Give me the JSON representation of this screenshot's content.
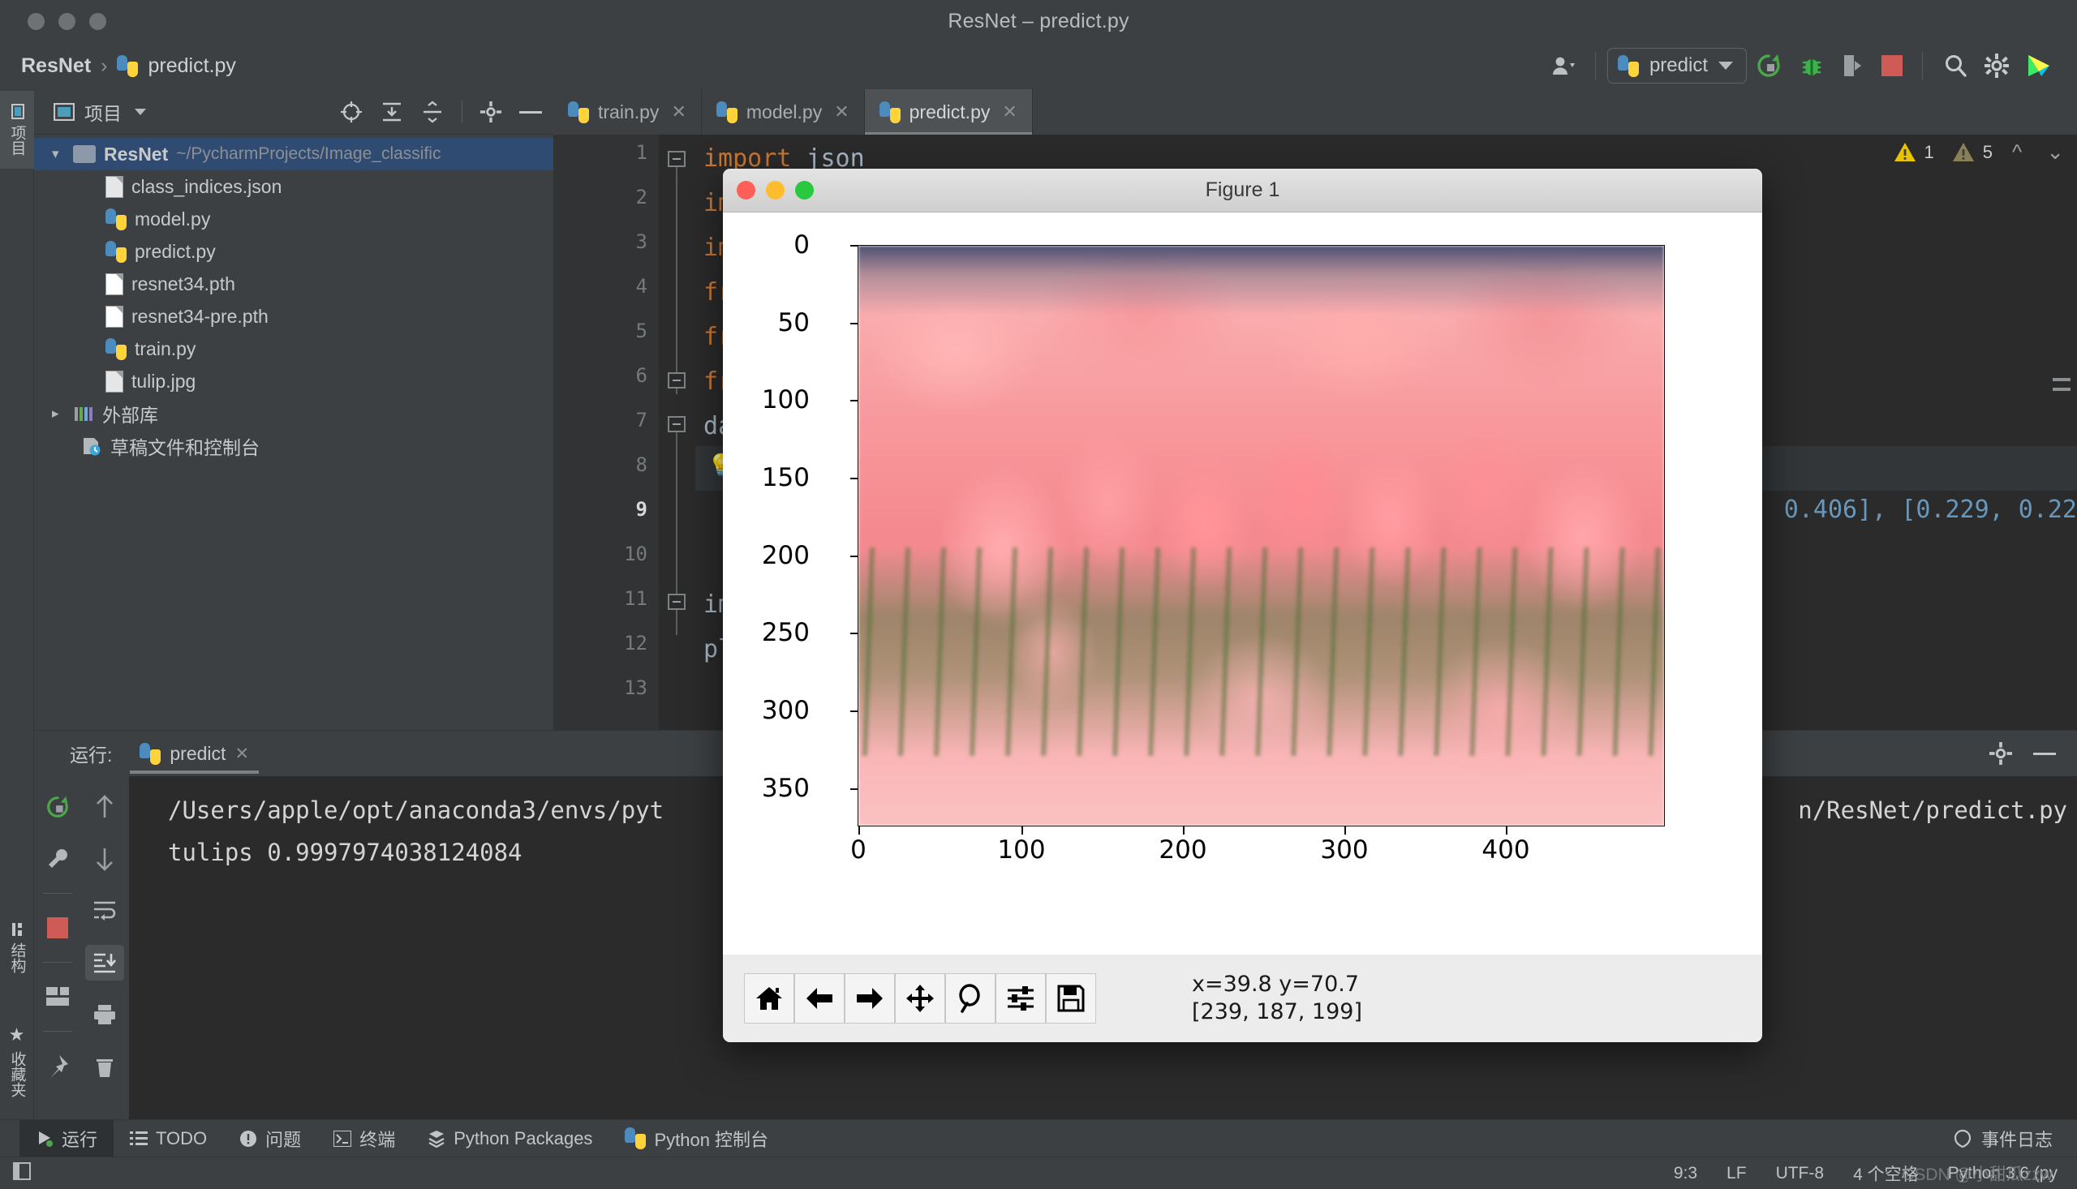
{
  "window": {
    "title": "ResNet – predict.py"
  },
  "breadcrumb": {
    "project": "ResNet",
    "separator": "›",
    "file": "predict.py"
  },
  "toolbar": {
    "run_config": "predict",
    "icons": [
      "user-icon",
      "rerun-icon",
      "debug-icon",
      "coverage-icon",
      "stop-icon",
      "search-icon",
      "settings-icon",
      "ide-logo-icon"
    ]
  },
  "vertical_tabs": {
    "project": "项目",
    "structure": "结构",
    "favorites": "收藏夹"
  },
  "project_panel": {
    "title": "项目",
    "root": {
      "name": "ResNet",
      "path": "~/PycharmProjects/Image_classific"
    },
    "items": [
      {
        "label": "class_indices.json",
        "icon": "json-file-icon"
      },
      {
        "label": "model.py",
        "icon": "python-file-icon"
      },
      {
        "label": "predict.py",
        "icon": "python-file-icon"
      },
      {
        "label": "resnet34.pth",
        "icon": "generic-file-icon"
      },
      {
        "label": "resnet34-pre.pth",
        "icon": "generic-file-icon"
      },
      {
        "label": "train.py",
        "icon": "python-file-icon"
      },
      {
        "label": "tulip.jpg",
        "icon": "image-file-icon"
      }
    ],
    "external_libraries": "外部库",
    "scratches": "草稿文件和控制台"
  },
  "editor": {
    "tabs": [
      {
        "label": "train.py",
        "active": false
      },
      {
        "label": "model.py",
        "active": false
      },
      {
        "label": "predict.py",
        "active": true
      }
    ],
    "warnings": {
      "error_count": "1",
      "warning_count": "5"
    },
    "line_numbers": [
      "1",
      "2",
      "3",
      "4",
      "5",
      "6",
      "7",
      "8",
      "9",
      "10",
      "11",
      "12",
      "13"
    ],
    "current_line": "9",
    "code_lines": [
      "import json",
      "imp",
      "imp",
      "fro",
      "fro",
      "fro",
      "dat",
      "",
      "",
      "",
      "",
      "img",
      "plt"
    ],
    "right_fragment": "0.406], [0.229, 0.22"
  },
  "run_panel": {
    "label": "运行:",
    "tab": "predict",
    "console_lines": [
      "/Users/apple/opt/anaconda3/envs/pyt",
      "tulips 0.9997974038124084"
    ],
    "console_right": "n/ResNet/predict.py",
    "sidebar_icons": [
      "rerun-icon",
      "wrench-icon",
      "stop-icon",
      "layout-icon",
      "pin-icon"
    ],
    "sidebar2_icons": [
      "up-arrow-icon",
      "down-arrow-icon",
      "soft-wrap-icon",
      "scroll-end-icon",
      "print-icon",
      "trash-icon"
    ]
  },
  "figure_window": {
    "title": "Figure 1",
    "toolbar_buttons": [
      "home-icon",
      "back-arrow-icon",
      "forward-arrow-icon",
      "pan-icon",
      "zoom-icon",
      "configure-subplots-icon",
      "save-icon"
    ],
    "coordinate_line1": "x=39.8 y=70.7",
    "coordinate_line2": "[239, 187, 199]"
  },
  "chart_data": {
    "type": "heatmap",
    "title": "",
    "xlabel": "",
    "ylabel": "",
    "x_ticks": [
      0,
      100,
      200,
      300,
      400
    ],
    "y_ticks": [
      0,
      50,
      100,
      150,
      200,
      250,
      300,
      350
    ],
    "xlim": [
      0,
      450
    ],
    "ylim": [
      375,
      0
    ],
    "grid": false,
    "legend": null,
    "description": "imshow of tulip.jpg - pink tulip field photograph, 450x375 pixels",
    "pixel_readout": {
      "x": 39.8,
      "y": 70.7,
      "rgb": [
        239,
        187,
        199
      ]
    }
  },
  "bottom_bar": {
    "items": [
      {
        "label": "运行",
        "icon": "run-icon",
        "active": true
      },
      {
        "label": "TODO",
        "icon": "todo-icon",
        "active": false
      },
      {
        "label": "问题",
        "icon": "problems-icon",
        "active": false
      },
      {
        "label": "终端",
        "icon": "terminal-icon",
        "active": false
      },
      {
        "label": "Python Packages",
        "icon": "packages-icon",
        "active": false
      },
      {
        "label": "Python 控制台",
        "icon": "python-console-icon",
        "active": false
      }
    ],
    "event_log": "事件日志"
  },
  "status_bar": {
    "caret": "9:3",
    "line_sep": "LF",
    "encoding": "UTF-8",
    "indent": "4 个空格",
    "interpreter": "Python 3.6 (py",
    "watermark": "CSDN @小甜瓜zzw"
  }
}
